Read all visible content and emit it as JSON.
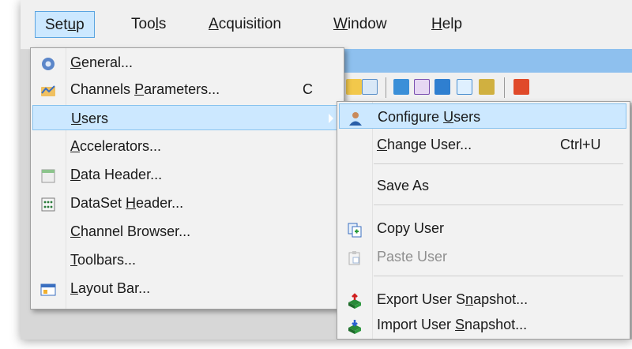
{
  "menubar": {
    "items": [
      {
        "pre": "Set",
        "u": "u",
        "post": "p"
      },
      {
        "pre": "Too",
        "u": "l",
        "post": "s"
      },
      {
        "pre": "",
        "u": "A",
        "post": "cquisition"
      },
      {
        "pre": "",
        "u": "W",
        "post": "indow"
      },
      {
        "pre": "",
        "u": "H",
        "post": "elp"
      }
    ]
  },
  "setup_menu": {
    "items": [
      {
        "pre": "",
        "u": "G",
        "post": "eneral...",
        "icon": "gear-icon"
      },
      {
        "pre": "Channels ",
        "u": "P",
        "post": "arameters...",
        "shortcut": "C",
        "icon": "channels-icon"
      },
      {
        "pre": "",
        "u": "U",
        "post": "sers"
      },
      {
        "pre": "",
        "u": "A",
        "post": "ccelerators..."
      },
      {
        "pre": "",
        "u": "D",
        "post": "ata Header...",
        "icon": "data-header-icon"
      },
      {
        "pre": "DataSet ",
        "u": "H",
        "post": "eader...",
        "icon": "dataset-header-icon"
      },
      {
        "pre": "",
        "u": "C",
        "post": "hannel Browser..."
      },
      {
        "pre": "",
        "u": "T",
        "post": "oolbars..."
      },
      {
        "pre": "",
        "u": "L",
        "post": "ayout Bar...",
        "icon": "layout-bar-icon"
      }
    ]
  },
  "users_menu": {
    "items": [
      {
        "pre": "Configure ",
        "u": "U",
        "post": "sers",
        "icon": "user-icon"
      },
      {
        "pre": "",
        "u": "C",
        "post": "hange User...",
        "shortcut": "Ctrl+U"
      },
      {
        "pre": "Save As",
        "u": "",
        "post": ""
      },
      {
        "pre": "Copy User",
        "u": "",
        "post": "",
        "icon": "copy-icon"
      },
      {
        "pre": "Paste User",
        "u": "",
        "post": "",
        "icon": "paste-icon"
      },
      {
        "pre": "Export User S",
        "u": "n",
        "post": "apshot...",
        "icon": "export-icon"
      },
      {
        "pre": "Import User ",
        "u": "S",
        "post": "napshot...",
        "icon": "import-icon"
      }
    ]
  },
  "colors": {
    "highlight": "#cce8ff",
    "highlight_border": "#88c2ee",
    "title_strip": "#8ec0ee"
  }
}
